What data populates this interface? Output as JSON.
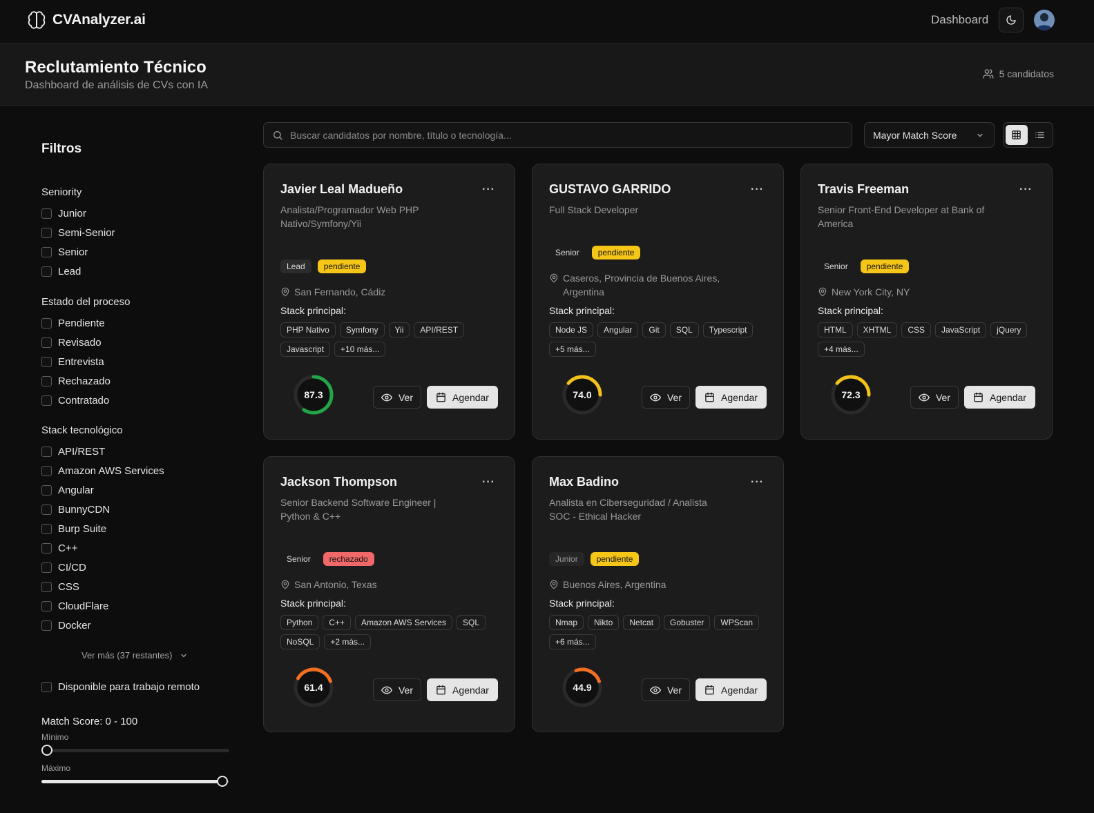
{
  "app": {
    "name": "CVAnalyzer.ai",
    "nav_dashboard": "Dashboard"
  },
  "header": {
    "title": "Reclutamiento Técnico",
    "subtitle": "Dashboard de análisis de CVs con IA",
    "count": "5 candidatos"
  },
  "filters": {
    "title": "Filtros",
    "seniority": {
      "title": "Seniority",
      "options": [
        "Junior",
        "Semi-Senior",
        "Senior",
        "Lead"
      ]
    },
    "status": {
      "title": "Estado del proceso",
      "options": [
        "Pendiente",
        "Revisado",
        "Entrevista",
        "Rechazado",
        "Contratado"
      ]
    },
    "stack": {
      "title": "Stack tecnológico",
      "options": [
        "API/REST",
        "Amazon AWS Services",
        "Angular",
        "BunnyCDN",
        "Burp Suite",
        "C++",
        "CI/CD",
        "CSS",
        "CloudFlare",
        "Docker"
      ],
      "more": "Ver más (37 restantes)"
    },
    "remote": "Disponible para trabajo remoto",
    "match": {
      "label": "Match Score: 0 - 100",
      "min_label": "Mínimo",
      "max_label": "Máximo",
      "min": 0,
      "max": 100
    }
  },
  "toolbar": {
    "search_placeholder": "Buscar candidatos por nombre, título o tecnología...",
    "sort": "Mayor Match Score"
  },
  "colors": {
    "pendiente": "#f5c518",
    "rechazado": "#f16868",
    "score_high": "#22a447",
    "score_mid": "#f2c21b",
    "score_low": "#f36f21"
  },
  "actions": {
    "view": "Ver",
    "schedule": "Agendar"
  },
  "candidates": [
    {
      "name": "Javier Leal Madueño",
      "title": "Analista/Programador Web PHP Nativo/Symfony/Yii",
      "level": "Lead",
      "status": "pendiente",
      "location": "San Fernando, Cádiz",
      "stack_label": "Stack principal:",
      "stack": [
        "PHP Nativo",
        "Symfony",
        "Yii",
        "API/REST",
        "Javascript",
        "+10 más..."
      ],
      "score": "87.3"
    },
    {
      "name": "GUSTAVO GARRIDO",
      "title": "Full Stack Developer",
      "level": "Senior",
      "status": "pendiente",
      "location": "Caseros, Provincia de Buenos Aires, Argentina",
      "stack_label": "Stack principal:",
      "stack": [
        "Node JS",
        "Angular",
        "Git",
        "SQL",
        "Typescript",
        "+5 más..."
      ],
      "score": "74.0"
    },
    {
      "name": "Travis Freeman",
      "title": "Senior Front-End Developer at Bank of America",
      "level": "Senior",
      "status": "pendiente",
      "location": "New York City, NY",
      "stack_label": "Stack principal:",
      "stack": [
        "HTML",
        "XHTML",
        "CSS",
        "JavaScript",
        "jQuery",
        "+4 más..."
      ],
      "score": "72.3"
    },
    {
      "name": "Jackson Thompson",
      "title": "Senior Backend Software Engineer | Python & C++",
      "level": "Senior",
      "status": "rechazado",
      "location": "San Antonio, Texas",
      "stack_label": "Stack principal:",
      "stack": [
        "Python",
        "C++",
        "Amazon AWS Services",
        "SQL",
        "NoSQL",
        "+2 más..."
      ],
      "score": "61.4"
    },
    {
      "name": "Max Badino",
      "title": "Analista en Ciberseguridad / Analista SOC - Ethical Hacker",
      "level": "Junior",
      "status": "pendiente",
      "location": "Buenos Aires, Argentina",
      "stack_label": "Stack principal:",
      "stack": [
        "Nmap",
        "Nikto",
        "Netcat",
        "Gobuster",
        "WPScan",
        "+6 más..."
      ],
      "score": "44.9"
    }
  ]
}
